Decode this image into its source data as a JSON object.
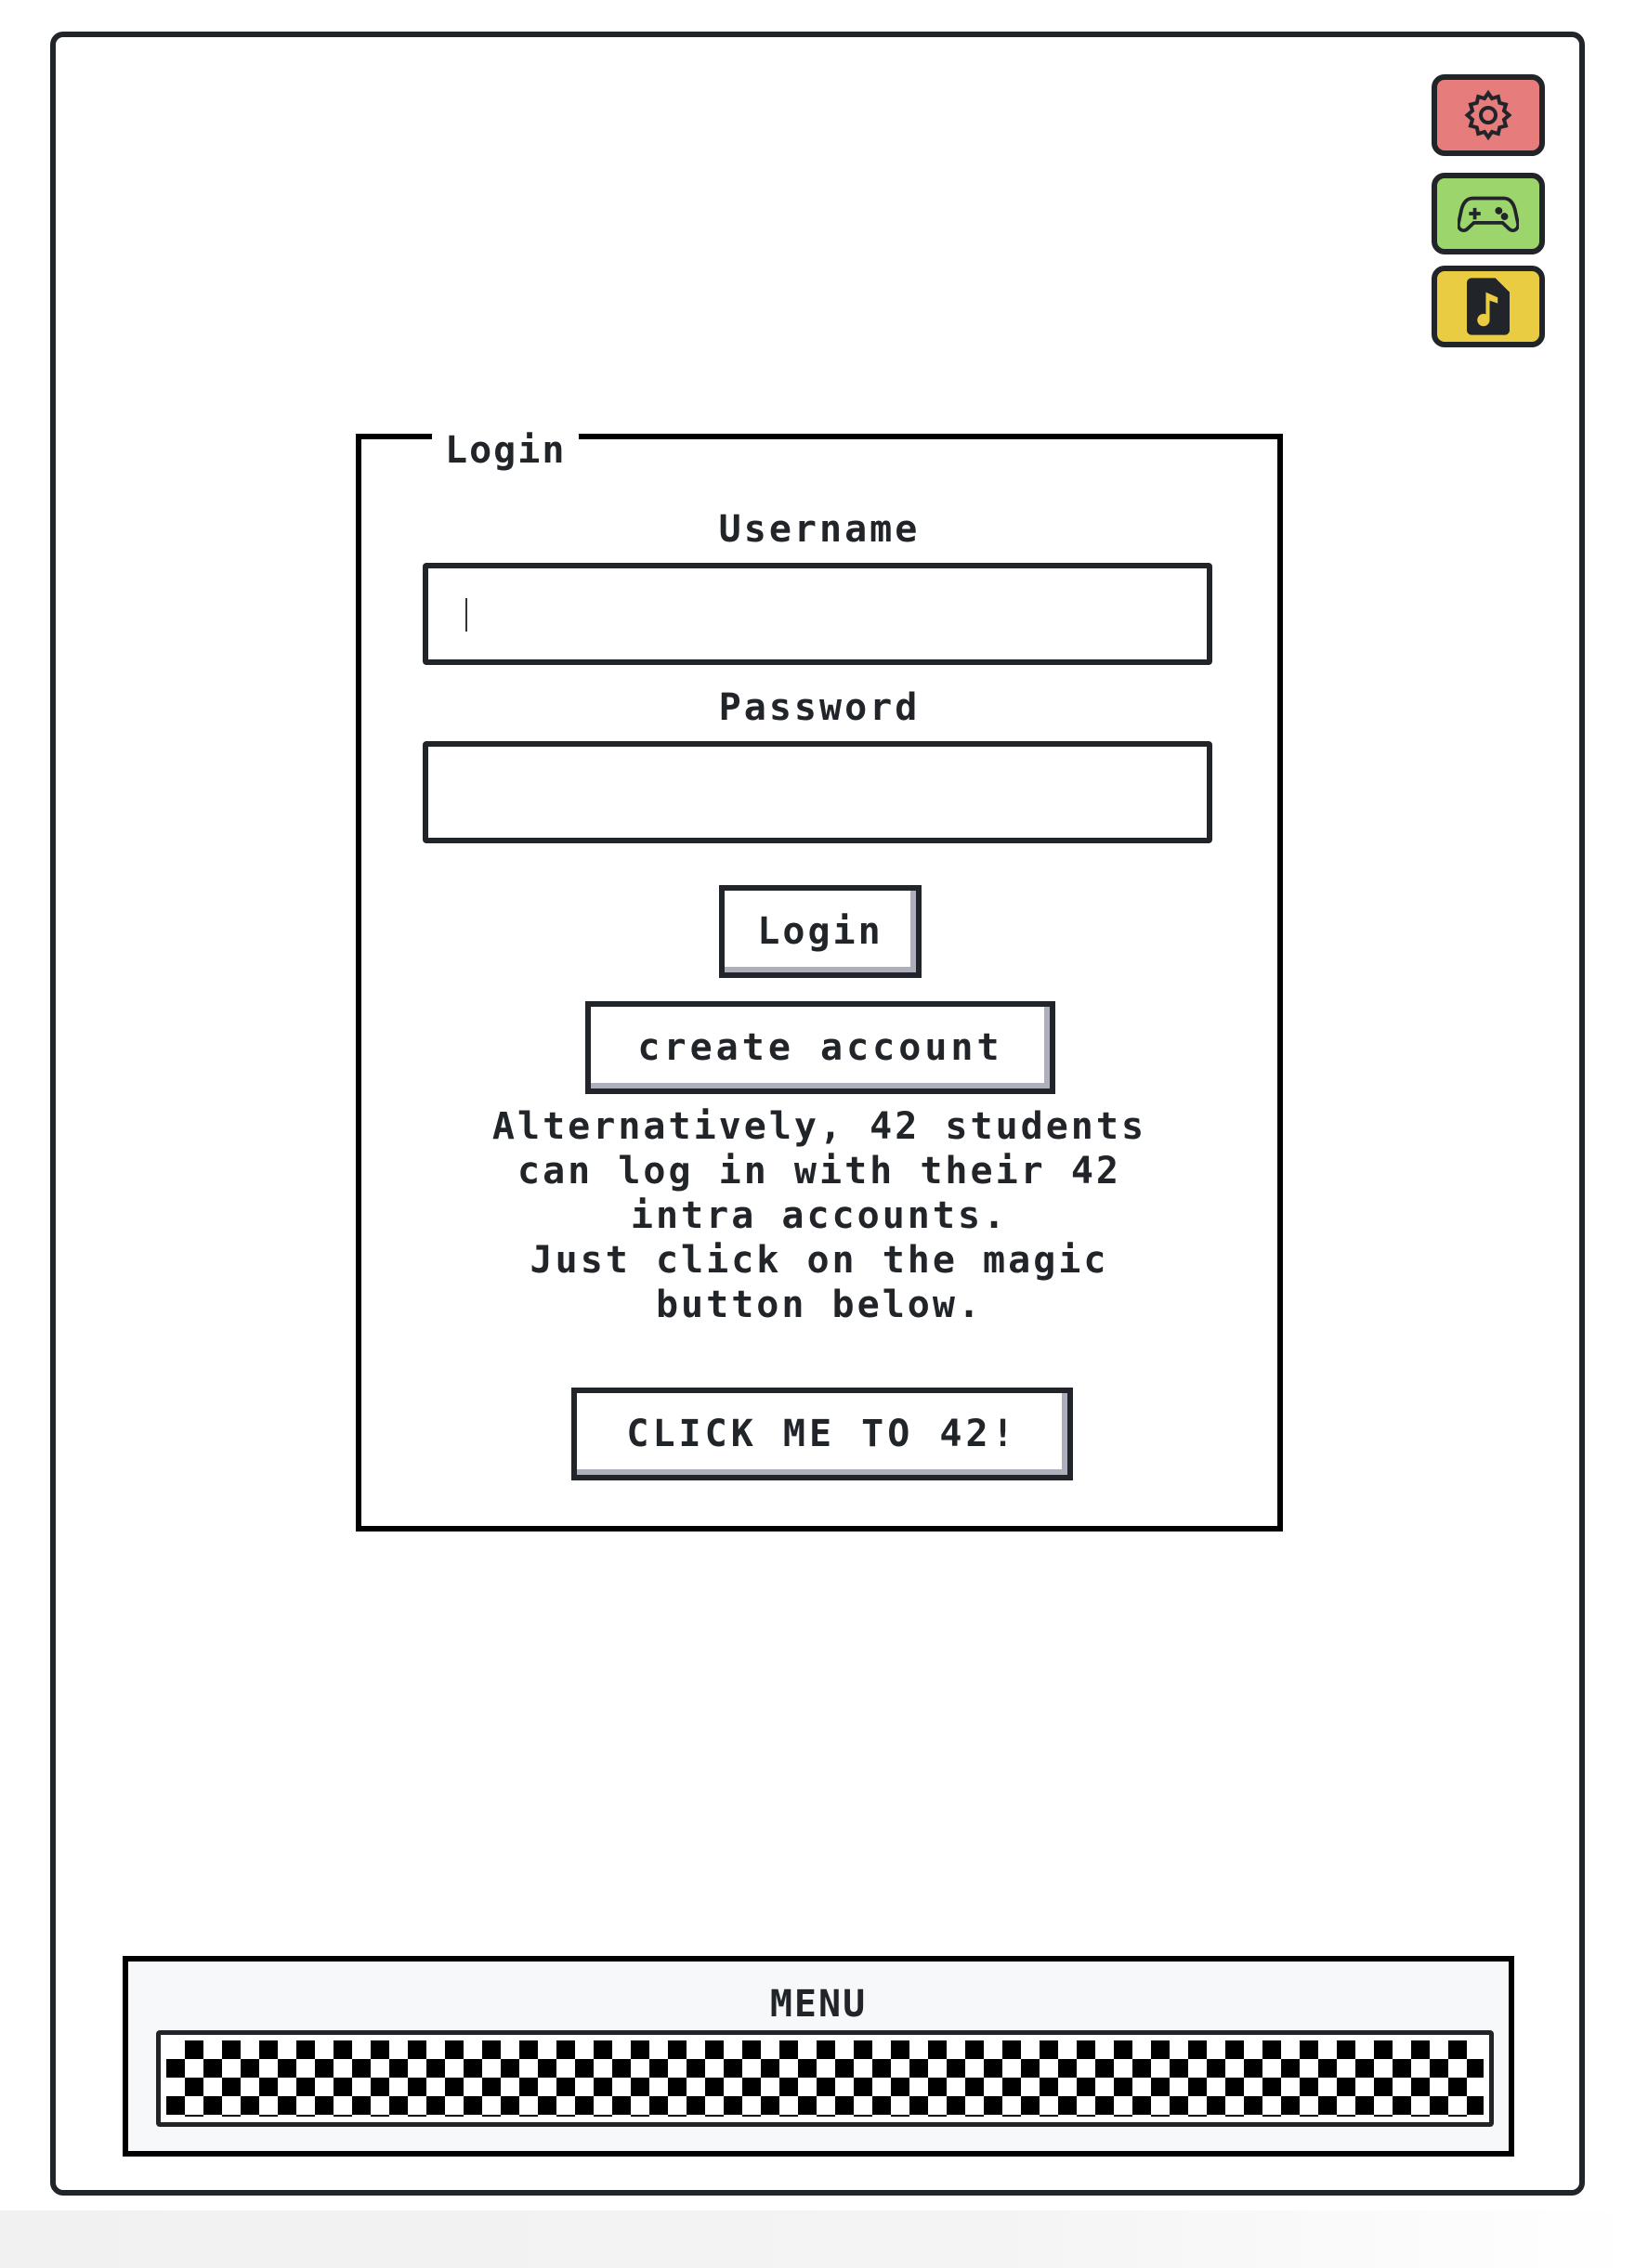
{
  "sidebar": {
    "buttons": [
      {
        "icon": "gear-icon",
        "color": "#e67c7c"
      },
      {
        "icon": "gamepad-icon",
        "color": "#9bd56b"
      },
      {
        "icon": "music-file-icon",
        "color": "#e9cc42"
      }
    ]
  },
  "login": {
    "legend": "Login",
    "username_label": "Username",
    "username_value": "",
    "password_label": "Password",
    "password_value": "",
    "login_button": "Login",
    "create_account_button": "create account",
    "info_lines": [
      "Alternatively, 42 students",
      "can log in with their 42",
      "intra accounts.",
      "Just click on the magic",
      "button below."
    ],
    "intra_button": "CLICK ME TO 42!"
  },
  "menu": {
    "title": "MENU"
  }
}
